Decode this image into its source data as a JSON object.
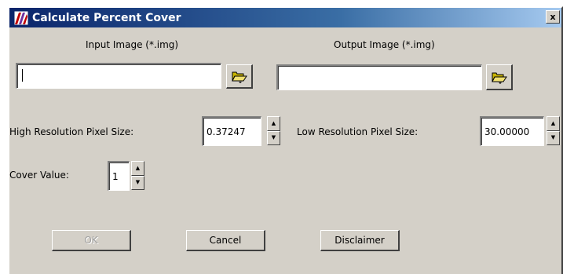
{
  "window": {
    "title": "Calculate Percent Cover",
    "close_label": "x"
  },
  "input_image": {
    "label": "Input Image (*.img)",
    "value": ""
  },
  "output_image": {
    "label": "Output Image (*.img)",
    "value": ""
  },
  "high_res": {
    "label": "High Resolution Pixel Size:",
    "value": "0.37247"
  },
  "low_res": {
    "label": "Low Resolution Pixel Size:",
    "value": "30.00000"
  },
  "cover": {
    "label": "Cover Value:",
    "value": "1"
  },
  "buttons": {
    "ok": "OK",
    "cancel": "Cancel",
    "disclaimer": "Disclaimer"
  },
  "icons": {
    "app": "erdas-app-icon",
    "browse": "folder-open-icon",
    "spin_up": "spin-up-icon",
    "spin_down": "spin-down-icon"
  },
  "colors": {
    "title_start": "#0a246a",
    "title_end": "#a6caf0",
    "face": "#d4d0c8"
  }
}
